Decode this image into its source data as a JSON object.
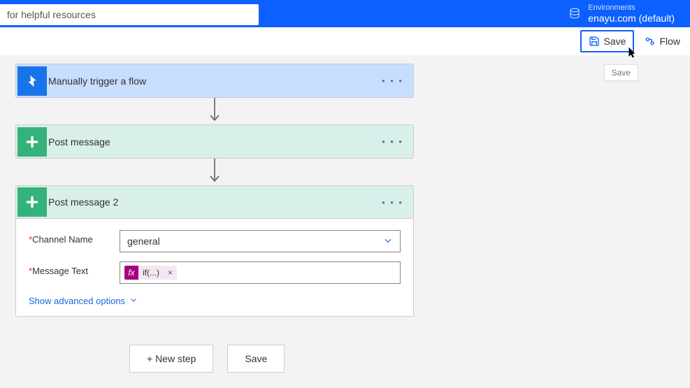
{
  "header": {
    "search_placeholder": "for helpful resources",
    "env_label": "Environments",
    "env_name": "enayu.com (default)"
  },
  "commands": {
    "save": "Save",
    "flow": "Flow",
    "save_tooltip": "Save"
  },
  "flow": {
    "trigger": {
      "title": "Manually trigger a flow"
    },
    "action1": {
      "title": "Post message"
    },
    "action2": {
      "title": "Post message 2",
      "channel_label": "Channel Name",
      "channel_value": "general",
      "message_label": "Message Text",
      "token_fx": "fx",
      "token_text": "if(...)",
      "advanced": "Show advanced options"
    }
  },
  "buttons": {
    "new_step": "+ New step",
    "save": "Save"
  }
}
